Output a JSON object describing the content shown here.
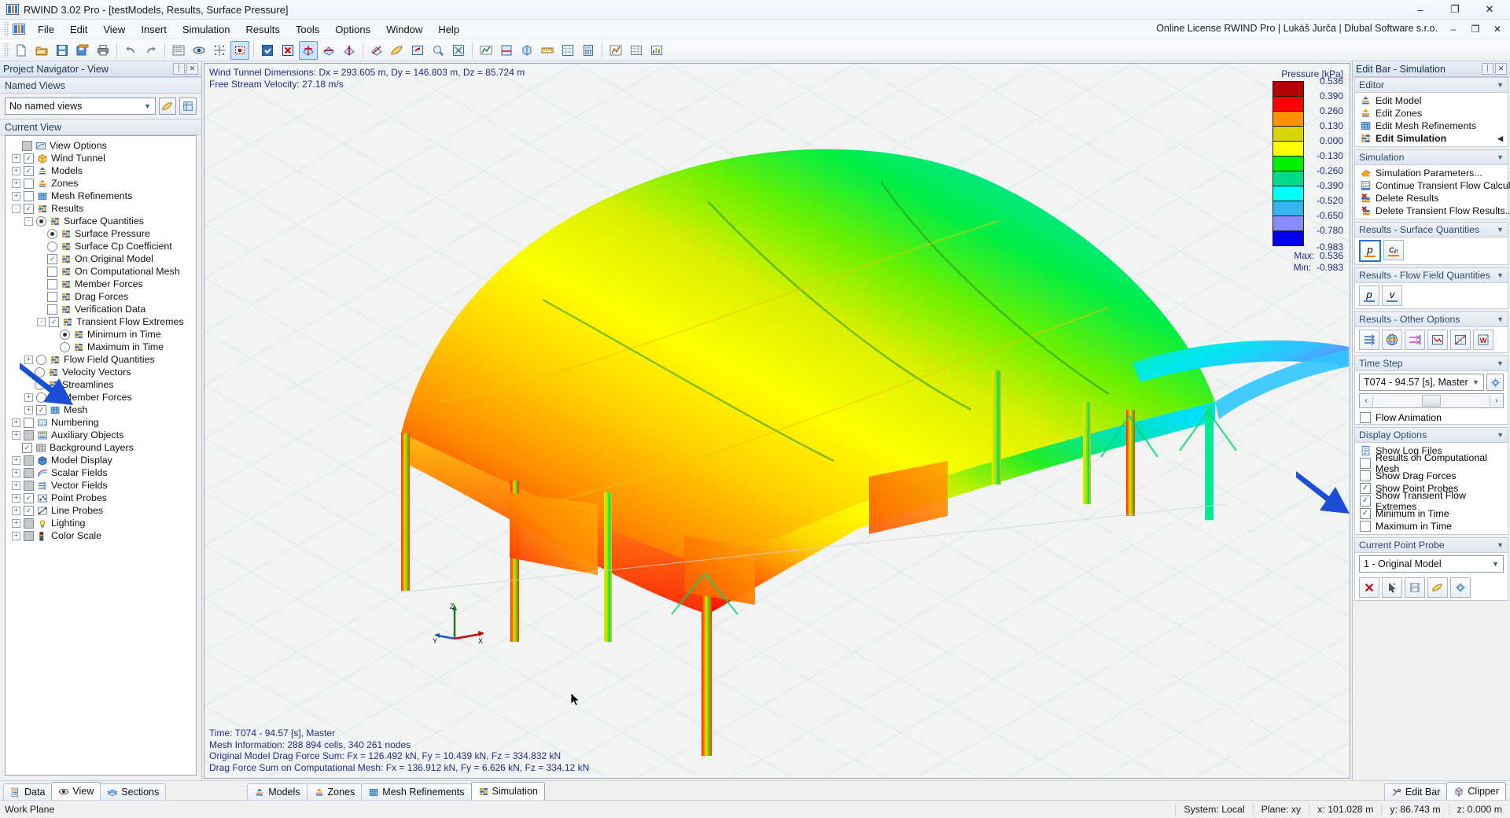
{
  "window": {
    "title": "RWIND 3.02 Pro - [testModels, Results, Surface Pressure]",
    "app_icon": "rwind-icon",
    "minimize": "–",
    "maximize": "❐",
    "close": "✕"
  },
  "menu": {
    "items": [
      "File",
      "Edit",
      "View",
      "Insert",
      "Simulation",
      "Results",
      "Tools",
      "Options",
      "Window",
      "Help"
    ],
    "license": "Online License RWIND Pro | Lukáš Jurča | Dlubal Software s.r.o.",
    "minimize": "–",
    "restore": "❐",
    "close": "✕"
  },
  "toolbar": {
    "groups": [
      [
        "new-file-icon",
        "open-folder-icon",
        "save-icon",
        "save-all-icon",
        "print-icon"
      ],
      [
        "undo-icon",
        "redo-icon"
      ],
      [
        "render-icon",
        "view-hidden-icon",
        "snap-grid-icon",
        "select-region-icon"
      ],
      [
        "zone-box-icon",
        "delete-box-icon",
        "rotate-x-icon",
        "rotate-y-icon",
        "rotate-z-icon"
      ],
      [
        "pan-icon",
        "shade-icon",
        "fit-view-icon",
        "zoom-window-icon",
        "zoom-all-icon"
      ],
      [
        "probe-icon",
        "section-icon",
        "clipper-icon",
        "measure-icon",
        "grid-icon",
        "calc-icon"
      ],
      [
        "wizard-icon",
        "table-icon",
        "chart-icon"
      ]
    ]
  },
  "navigator": {
    "caption": "Project Navigator - View",
    "cap_pin": "⏐",
    "cap_close": "✕",
    "named_views_header": "Named Views",
    "named_views_value": "No named views",
    "current_view_header": "Current View",
    "tree": [
      {
        "label": "View Options",
        "depth": 0,
        "exp": "",
        "ctrl": "chk-gray",
        "icon": "view-options-icon"
      },
      {
        "label": "Wind Tunnel",
        "depth": 0,
        "exp": "+",
        "ctrl": "chk-on",
        "icon": "wind-tunnel-icon"
      },
      {
        "label": "Models",
        "depth": 0,
        "exp": "+",
        "ctrl": "chk-on",
        "icon": "model-icon"
      },
      {
        "label": "Zones",
        "depth": 0,
        "exp": "+",
        "ctrl": "chk-off",
        "icon": "zones-icon"
      },
      {
        "label": "Mesh Refinements",
        "depth": 0,
        "exp": "+",
        "ctrl": "chk-off",
        "icon": "mesh-refine-icon"
      },
      {
        "label": "Results",
        "depth": 0,
        "exp": "-",
        "ctrl": "chk-on",
        "icon": "results-icon"
      },
      {
        "label": "Surface Quantities",
        "depth": 1,
        "exp": "-",
        "ctrl": "rad-on",
        "icon": "results-icon"
      },
      {
        "label": "Surface Pressure",
        "depth": 2,
        "exp": "",
        "ctrl": "rad-on",
        "icon": "results-icon"
      },
      {
        "label": "Surface Cp Coefficient",
        "depth": 2,
        "exp": "",
        "ctrl": "rad-off",
        "icon": "results-icon"
      },
      {
        "label": "On Original Model",
        "depth": 2,
        "exp": "",
        "ctrl": "chk-on",
        "icon": "results-icon"
      },
      {
        "label": "On Computational Mesh",
        "depth": 2,
        "exp": "",
        "ctrl": "chk-off",
        "icon": "results-icon"
      },
      {
        "label": "Member Forces",
        "depth": 2,
        "exp": "",
        "ctrl": "chk-off",
        "icon": "results-icon"
      },
      {
        "label": "Drag Forces",
        "depth": 2,
        "exp": "",
        "ctrl": "chk-off",
        "icon": "results-icon"
      },
      {
        "label": "Verification Data",
        "depth": 2,
        "exp": "",
        "ctrl": "chk-off",
        "icon": "results-icon"
      },
      {
        "label": "Transient Flow Extremes",
        "depth": 2,
        "exp": "-",
        "ctrl": "chk-on",
        "icon": "results-icon"
      },
      {
        "label": "Minimum in Time",
        "depth": 3,
        "exp": "",
        "ctrl": "rad-on",
        "icon": "results-icon"
      },
      {
        "label": "Maximum in Time",
        "depth": 3,
        "exp": "",
        "ctrl": "rad-off",
        "icon": "results-icon"
      },
      {
        "label": "Flow Field Quantities",
        "depth": 1,
        "exp": "+",
        "ctrl": "rad-off",
        "icon": "results-icon"
      },
      {
        "label": "Velocity Vectors",
        "depth": 1,
        "exp": "",
        "ctrl": "rad-off",
        "icon": "results-icon"
      },
      {
        "label": "Streamlines",
        "depth": 1,
        "exp": "",
        "ctrl": "rad-off",
        "icon": "results-icon"
      },
      {
        "label": "Member Forces",
        "depth": 1,
        "exp": "+",
        "ctrl": "rad-off",
        "icon": "results-icon"
      },
      {
        "label": "Mesh",
        "depth": 1,
        "exp": "+",
        "ctrl": "chk-on",
        "icon": "mesh-icon"
      },
      {
        "label": "Numbering",
        "depth": 0,
        "exp": "+",
        "ctrl": "chk-off",
        "icon": "numbering-icon"
      },
      {
        "label": "Auxiliary Objects",
        "depth": 0,
        "exp": "+",
        "ctrl": "chk-gray",
        "icon": "auxiliary-icon"
      },
      {
        "label": "Background Layers",
        "depth": 0,
        "exp": "",
        "ctrl": "chk-on",
        "icon": "background-icon"
      },
      {
        "label": "Model Display",
        "depth": 0,
        "exp": "+",
        "ctrl": "chk-gray",
        "icon": "model-display-icon"
      },
      {
        "label": "Scalar Fields",
        "depth": 0,
        "exp": "+",
        "ctrl": "chk-gray",
        "icon": "scalar-fields-icon"
      },
      {
        "label": "Vector Fields",
        "depth": 0,
        "exp": "+",
        "ctrl": "chk-gray",
        "icon": "vector-fields-icon"
      },
      {
        "label": "Point Probes",
        "depth": 0,
        "exp": "+",
        "ctrl": "chk-on",
        "icon": "point-probes-icon"
      },
      {
        "label": "Line Probes",
        "depth": 0,
        "exp": "+",
        "ctrl": "chk-on",
        "icon": "line-probes-icon"
      },
      {
        "label": "Lighting",
        "depth": 0,
        "exp": "+",
        "ctrl": "chk-gray",
        "icon": "lighting-icon"
      },
      {
        "label": "Color Scale",
        "depth": 0,
        "exp": "+",
        "ctrl": "chk-gray",
        "icon": "color-scale-icon"
      }
    ]
  },
  "viewport": {
    "info_lines": [
      "Wind Tunnel Dimensions: Dx = 293.605 m, Dy = 146.803 m, Dz = 85.724 m",
      "Free Stream Velocity: 27.18 m/s"
    ],
    "bottom_lines": [
      "Time: T074 - 94.57 [s], Master",
      "Mesh Information: 288 894 cells, 340 261 nodes",
      "Original Model Drag Force Sum: Fx = 126.492 kN, Fy = 10.439 kN, Fz = 334.832 kN",
      "Drag Force Sum on Computational Mesh: Fx = 136.912 kN, Fy = 6.626 kN, Fz = 334.12 kN"
    ],
    "axes": {
      "x": "X",
      "y": "Y",
      "z": "Z"
    }
  },
  "legend": {
    "title": "Pressure [kPa]",
    "values": [
      "0.536",
      "0.390",
      "0.260",
      "0.130",
      "0.000",
      "-0.130",
      "-0.260",
      "-0.390",
      "-0.520",
      "-0.650",
      "-0.780",
      "-0.983"
    ],
    "colors": [
      "#b40000",
      "#ff0000",
      "#ff9000",
      "#d8d400",
      "#ffff00",
      "#00ee00",
      "#00d88a",
      "#00ffff",
      "#35b4ee",
      "#8a8aff",
      "#0000ee"
    ],
    "max_label": "Max:",
    "max_value": "0.536",
    "min_label": "Min:",
    "min_value": "-0.983"
  },
  "editbar": {
    "caption": "Edit Bar - Simulation",
    "cap_pin": "⏐",
    "cap_close": "✕",
    "collapse_arrow": "▼",
    "sections": {
      "editor": {
        "title": "Editor",
        "items": [
          {
            "label": "Edit Model",
            "icon": "model-icon",
            "bold": false
          },
          {
            "label": "Edit Zones",
            "icon": "zones-icon",
            "bold": false
          },
          {
            "label": "Edit Mesh Refinements",
            "icon": "mesh-refine-icon",
            "bold": false
          },
          {
            "label": "Edit Simulation",
            "icon": "results-icon",
            "bold": true,
            "marker": "◀"
          }
        ]
      },
      "simulation": {
        "title": "Simulation",
        "items": [
          {
            "label": "Simulation Parameters...",
            "icon": "params-icon"
          },
          {
            "label": "Continue Transient Flow Calculat...",
            "icon": "continue-icon"
          },
          {
            "label": "Delete Results",
            "icon": "delete-results-icon"
          },
          {
            "label": "Delete Transient Flow Results...",
            "icon": "delete-transient-icon"
          }
        ]
      },
      "surface_quantities": {
        "title": "Results - Surface Quantities",
        "buttons": [
          {
            "name": "pressure-button",
            "label": "p",
            "selected": true,
            "bar": "#ff7b00"
          },
          {
            "name": "cp-button",
            "label": "cₚ",
            "selected": false,
            "bar": "#ff7b00"
          }
        ]
      },
      "flow_field": {
        "title": "Results - Flow Field Quantities",
        "buttons": [
          {
            "name": "flow-pressure-button",
            "label": "p",
            "selected": false,
            "bar": "#2f88d8"
          },
          {
            "name": "flow-velocity-button",
            "label": "v",
            "selected": false,
            "bar": "#2f88d8"
          }
        ]
      },
      "other_options": {
        "title": "Results - Other Options",
        "buttons": [
          "velocity-vectors-icon",
          "streamlines-icon",
          "flow-lines-icon",
          "graph-icon",
          "diagram-icon",
          "word-report-icon"
        ]
      },
      "time_step": {
        "title": "Time Step",
        "value": "T074 - 94.57 [s], Master",
        "settings_icon": "gear-icon",
        "scroll_left": "‹",
        "scroll_right": "›",
        "flow_animation": {
          "label": "Flow Animation",
          "checked": false
        }
      },
      "display_options": {
        "title": "Display Options",
        "items": [
          {
            "label": "Show Log Files",
            "type": "icon",
            "icon": "log-file-icon"
          },
          {
            "label": "Results on Computational Mesh",
            "type": "check",
            "checked": false
          },
          {
            "label": "Show Drag Forces",
            "type": "check",
            "checked": false
          },
          {
            "label": "Show Point Probes",
            "type": "check",
            "checked": true
          },
          {
            "label": "Show Transient Flow Extremes",
            "type": "check",
            "checked": true
          },
          {
            "label": "Minimum in Time",
            "type": "check",
            "checked": true
          },
          {
            "label": "Maximum in Time",
            "type": "check",
            "checked": false
          }
        ]
      },
      "point_probe": {
        "title": "Current Point Probe",
        "value": "1 - Original Model",
        "buttons": [
          "delete-probe-icon",
          "pick-probe-icon",
          "save-probe-icon",
          "view-probe-icon",
          "settings-probe-icon"
        ]
      }
    }
  },
  "bottom_tabs": {
    "left": [
      {
        "label": "Data",
        "icon": "data-icon",
        "active": false
      },
      {
        "label": "View",
        "icon": "view-eye-icon",
        "active": true
      },
      {
        "label": "Sections",
        "icon": "sections-icon",
        "active": false
      }
    ],
    "center": [
      {
        "label": "Models",
        "icon": "model-icon",
        "active": false
      },
      {
        "label": "Zones",
        "icon": "zones-icon",
        "active": false
      },
      {
        "label": "Mesh Refinements",
        "icon": "mesh-refine-icon",
        "active": false
      },
      {
        "label": "Simulation",
        "icon": "results-icon",
        "active": true
      }
    ],
    "right": [
      {
        "label": "Edit Bar",
        "icon": "tools-icon",
        "active": false
      },
      {
        "label": "Clipper",
        "icon": "clipper-icon",
        "active": true
      }
    ]
  },
  "statusbar": {
    "left": "Work Plane",
    "system": "System: Local",
    "plane": "Plane: xy",
    "x": "x:  101.028 m",
    "y": "y:  86.743 m",
    "z": "z:  0.000 m"
  }
}
